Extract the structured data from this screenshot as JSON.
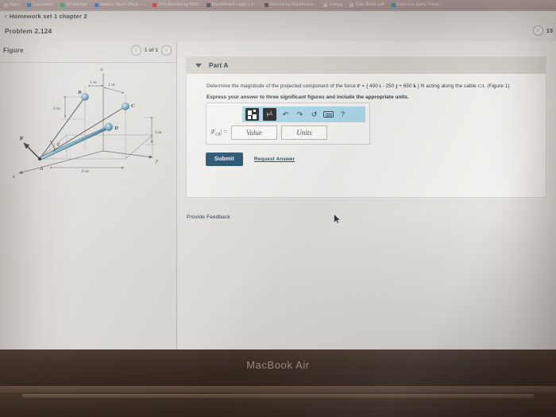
{
  "browser": {
    "bookmarks": [
      {
        "label": "Apps",
        "favicon": "apps-icon",
        "color": "grey"
      },
      {
        "label": "Calculator",
        "favicon": "calculator-icon",
        "color": "blue"
      },
      {
        "label": "WhatsApp",
        "favicon": "whatsapp-icon",
        "color": "green"
      },
      {
        "label": "Statics Study Pack -...",
        "favicon": "doc-icon",
        "color": "blue"
      },
      {
        "label": "STA Mastering ENG",
        "favicon": "mastering-icon",
        "color": "red"
      },
      {
        "label": "Blackboard Login | F...",
        "favicon": "blackboard-icon",
        "color": "dark"
      },
      {
        "label": "Rounding Significant...",
        "favicon": "sigma-icon",
        "color": "dark"
      },
      {
        "label": "Chegg",
        "favicon": "page-icon",
        "color": "grey"
      },
      {
        "label": "Calc Book.pdf",
        "favicon": "pdf-icon",
        "color": "grey"
      },
      {
        "label": "Calculus Early Trans...",
        "favicon": "calculus-icon",
        "color": "teal"
      }
    ]
  },
  "header": {
    "breadcrumb_chevron": "‹",
    "breadcrumb": "Homework set 1 chapter 2",
    "problem_title": "Problem 2.124",
    "pager": {
      "prev_icon": "chevron-left-icon",
      "value": "13"
    }
  },
  "part": {
    "caret_icon": "caret-down-icon",
    "label": "Part A",
    "question_prefix": "Determine the magnitude of the projected component of the force ",
    "force_symbol": "F",
    "force_eq": " = { 400 ",
    "i_hat": "i",
    "force_mid1": " - 250 ",
    "j_hat": "j",
    "force_mid2": " + 650 ",
    "k_hat": "k",
    "force_suffix": " } N acting along the cable ",
    "cable": "CA",
    "figure_ref": ". (Figure 1)",
    "instruction": "Express your answer to three significant figures and include the appropriate units."
  },
  "entry": {
    "toolbar": [
      {
        "name": "template-matrix-icon",
        "glyph": ""
      },
      {
        "name": "units-micro-angstrom-icon",
        "glyph": "µÅ"
      },
      {
        "name": "undo-icon",
        "glyph": "↶"
      },
      {
        "name": "redo-icon",
        "glyph": "↷"
      },
      {
        "name": "reset-icon",
        "glyph": "↺"
      },
      {
        "name": "keyboard-icon",
        "glyph": ""
      },
      {
        "name": "help-icon",
        "glyph": "?"
      }
    ],
    "field_label_prefix": "|F",
    "field_label_sub": "CA",
    "field_label_suffix": "| =",
    "value_placeholder": "Value",
    "units_placeholder": "Units",
    "value": "",
    "units": ""
  },
  "actions": {
    "submit_label": "Submit",
    "request_answer_label": "Request Answer",
    "provide_feedback_label": "Provide Feedback"
  },
  "figure": {
    "panel_title": "Figure",
    "prev_icon": "chevron-left-icon",
    "next_icon": "chevron-right-icon",
    "counter": "1 of 1",
    "labels": {
      "axis_z": "z",
      "axis_x": "x",
      "axis_y": "y",
      "point_a": "A",
      "point_b": "B",
      "point_c": "C",
      "point_d": "D",
      "force_f": "F",
      "angle_theta": "θ",
      "dim_2m": "2 m",
      "dim_1m_left": "1 m",
      "dim_1m_right": "1 m",
      "dim_3m": "3 m",
      "dim_6m": "6 m"
    }
  },
  "device": {
    "brand": "MacBook Air"
  },
  "colors": {
    "accent_submit": "#1d4d6b",
    "toolbar_blue": "#a9d8ea",
    "part_header": "#d3d1c9",
    "page_bg": "#dedcd8",
    "cable_blue": "#3f82a8",
    "link": "#1f4b66"
  }
}
